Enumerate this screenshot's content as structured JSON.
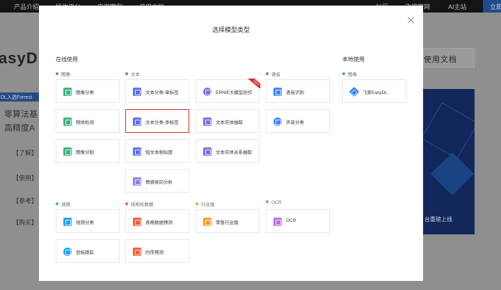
{
  "background": {
    "nav": {
      "product_intro": "产品介绍",
      "operation_platform": "操作平台",
      "cases": "应用案例",
      "docs": "使用文档",
      "community": "社区",
      "paddle_official": "飞桨官网",
      "ai_studio": "AI主站",
      "free_label": "立即"
    },
    "logo_text": "asyDL",
    "tag_text": "DL入选Forrest",
    "line1": "零算法基",
    "line2": "高精度A",
    "side_items": [
      "【了解】",
      "【使用】",
      "【参考】",
      "【购买】"
    ],
    "doc_button": "使用文档",
    "banner_caption": "台重磅上线"
  },
  "modal": {
    "title": "选择模型类型",
    "online_section": "在线使用",
    "local_section": "本地使用",
    "colors": {
      "image": "#36b37e",
      "text": "#7b6fe6",
      "audio": "#3f87ff",
      "video": "#35a7ff",
      "structured": "#ff5a3c",
      "industry": "#ff9d2e",
      "ocr": "#c46ce0",
      "selected_border": "#e02020"
    },
    "categories": {
      "image": "图像",
      "text": "文本",
      "audio": "语音",
      "local_image": "图像",
      "video": "视频",
      "structured": "结构化数据",
      "industry": "行业版",
      "ocr": "OCR"
    },
    "cards": {
      "image_classify": {
        "label": "图像分类",
        "icon": "image-icon",
        "color": "#36b37e"
      },
      "object_detect": {
        "label": "物体检测",
        "icon": "detect-icon",
        "color": "#36b37e"
      },
      "image_segment": {
        "label": "图像分割",
        "icon": "segment-icon",
        "color": "#36b37e"
      },
      "text_single": {
        "label": "文本分类-单标签",
        "icon": "text-icon",
        "color": "#5c6ef2"
      },
      "text_multi": {
        "label": "文本分类-多标签",
        "icon": "text-icon",
        "color": "#5c6ef2",
        "selected": true
      },
      "short_text": {
        "label": "短文本相似度",
        "icon": "doc-icon",
        "color": "#5c6ef2"
      },
      "sentiment": {
        "label": "情感倾向分析",
        "icon": "sentiment-icon",
        "color": "#8f7ef0"
      },
      "ernie": {
        "label": "ERNIE大模型创作",
        "icon": "ernie-icon",
        "color": "#7b6fe6",
        "badge": "NEW"
      },
      "entity": {
        "label": "文本实体抽取",
        "icon": "entity-icon",
        "color": "#7b6fe6"
      },
      "relation": {
        "label": "文本实体关系抽取",
        "icon": "relation-icon",
        "color": "#7b6fe6"
      },
      "speech": {
        "label": "语音识别",
        "icon": "microphone-icon",
        "color": "#3f87ff"
      },
      "sound": {
        "label": "声音分类",
        "icon": "sound-icon",
        "color": "#3f87ff"
      },
      "paddle_easydl": {
        "label": "飞桨EasyDL",
        "icon": "cube-icon",
        "color": "#2d7ff9"
      },
      "video_classify": {
        "label": "视频分类",
        "icon": "video-icon",
        "color": "#1fa2ff"
      },
      "target_track": {
        "label": "目标跟踪",
        "icon": "target-icon",
        "color": "#1fa2ff"
      },
      "table_predict": {
        "label": "表格数据预测",
        "icon": "table-icon",
        "color": "#ff5a3c"
      },
      "time_series": {
        "label": "时序预测",
        "icon": "chart-icon",
        "color": "#ff5a3c"
      },
      "retail": {
        "label": "零售行业版",
        "icon": "retail-icon",
        "color": "#ff9d2e"
      },
      "ocr": {
        "label": "OCR",
        "icon": "ocr-icon",
        "color": "#c46ce0"
      }
    }
  }
}
